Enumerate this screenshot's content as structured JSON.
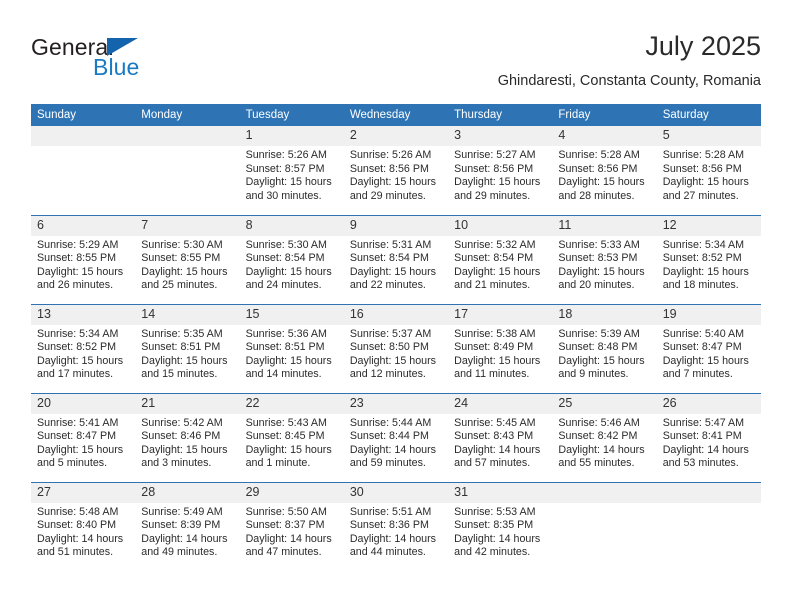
{
  "logo": {
    "word_one": "General",
    "word_two": "Blue",
    "triangle_color": "#1464ad",
    "blue_text_color": "#1a7ac4"
  },
  "header": {
    "month_title": "July 2025",
    "location": "Ghindaresti, Constanta County, Romania"
  },
  "theme": {
    "header_blue": "#2e74b5",
    "daynum_band": "#f0f0f0",
    "body_text": "#2b2b2b"
  },
  "weekday_headers": [
    "Sunday",
    "Monday",
    "Tuesday",
    "Wednesday",
    "Thursday",
    "Friday",
    "Saturday"
  ],
  "labels": {
    "sunrise_prefix": "Sunrise:",
    "sunset_prefix": "Sunset:",
    "daylight_prefix": "Daylight:"
  },
  "weeks": [
    [
      {
        "day": "",
        "empty": true,
        "sunrise": "",
        "sunset": "",
        "daylight_line1": "",
        "daylight_line2": ""
      },
      {
        "day": "",
        "empty": true,
        "sunrise": "",
        "sunset": "",
        "daylight_line1": "",
        "daylight_line2": ""
      },
      {
        "day": "1",
        "empty": false,
        "sunrise": "Sunrise: 5:26 AM",
        "sunset": "Sunset: 8:57 PM",
        "daylight_line1": "Daylight: 15 hours",
        "daylight_line2": "and 30 minutes."
      },
      {
        "day": "2",
        "empty": false,
        "sunrise": "Sunrise: 5:26 AM",
        "sunset": "Sunset: 8:56 PM",
        "daylight_line1": "Daylight: 15 hours",
        "daylight_line2": "and 29 minutes."
      },
      {
        "day": "3",
        "empty": false,
        "sunrise": "Sunrise: 5:27 AM",
        "sunset": "Sunset: 8:56 PM",
        "daylight_line1": "Daylight: 15 hours",
        "daylight_line2": "and 29 minutes."
      },
      {
        "day": "4",
        "empty": false,
        "sunrise": "Sunrise: 5:28 AM",
        "sunset": "Sunset: 8:56 PM",
        "daylight_line1": "Daylight: 15 hours",
        "daylight_line2": "and 28 minutes."
      },
      {
        "day": "5",
        "empty": false,
        "sunrise": "Sunrise: 5:28 AM",
        "sunset": "Sunset: 8:56 PM",
        "daylight_line1": "Daylight: 15 hours",
        "daylight_line2": "and 27 minutes."
      }
    ],
    [
      {
        "day": "6",
        "empty": false,
        "sunrise": "Sunrise: 5:29 AM",
        "sunset": "Sunset: 8:55 PM",
        "daylight_line1": "Daylight: 15 hours",
        "daylight_line2": "and 26 minutes."
      },
      {
        "day": "7",
        "empty": false,
        "sunrise": "Sunrise: 5:30 AM",
        "sunset": "Sunset: 8:55 PM",
        "daylight_line1": "Daylight: 15 hours",
        "daylight_line2": "and 25 minutes."
      },
      {
        "day": "8",
        "empty": false,
        "sunrise": "Sunrise: 5:30 AM",
        "sunset": "Sunset: 8:54 PM",
        "daylight_line1": "Daylight: 15 hours",
        "daylight_line2": "and 24 minutes."
      },
      {
        "day": "9",
        "empty": false,
        "sunrise": "Sunrise: 5:31 AM",
        "sunset": "Sunset: 8:54 PM",
        "daylight_line1": "Daylight: 15 hours",
        "daylight_line2": "and 22 minutes."
      },
      {
        "day": "10",
        "empty": false,
        "sunrise": "Sunrise: 5:32 AM",
        "sunset": "Sunset: 8:54 PM",
        "daylight_line1": "Daylight: 15 hours",
        "daylight_line2": "and 21 minutes."
      },
      {
        "day": "11",
        "empty": false,
        "sunrise": "Sunrise: 5:33 AM",
        "sunset": "Sunset: 8:53 PM",
        "daylight_line1": "Daylight: 15 hours",
        "daylight_line2": "and 20 minutes."
      },
      {
        "day": "12",
        "empty": false,
        "sunrise": "Sunrise: 5:34 AM",
        "sunset": "Sunset: 8:52 PM",
        "daylight_line1": "Daylight: 15 hours",
        "daylight_line2": "and 18 minutes."
      }
    ],
    [
      {
        "day": "13",
        "empty": false,
        "sunrise": "Sunrise: 5:34 AM",
        "sunset": "Sunset: 8:52 PM",
        "daylight_line1": "Daylight: 15 hours",
        "daylight_line2": "and 17 minutes."
      },
      {
        "day": "14",
        "empty": false,
        "sunrise": "Sunrise: 5:35 AM",
        "sunset": "Sunset: 8:51 PM",
        "daylight_line1": "Daylight: 15 hours",
        "daylight_line2": "and 15 minutes."
      },
      {
        "day": "15",
        "empty": false,
        "sunrise": "Sunrise: 5:36 AM",
        "sunset": "Sunset: 8:51 PM",
        "daylight_line1": "Daylight: 15 hours",
        "daylight_line2": "and 14 minutes."
      },
      {
        "day": "16",
        "empty": false,
        "sunrise": "Sunrise: 5:37 AM",
        "sunset": "Sunset: 8:50 PM",
        "daylight_line1": "Daylight: 15 hours",
        "daylight_line2": "and 12 minutes."
      },
      {
        "day": "17",
        "empty": false,
        "sunrise": "Sunrise: 5:38 AM",
        "sunset": "Sunset: 8:49 PM",
        "daylight_line1": "Daylight: 15 hours",
        "daylight_line2": "and 11 minutes."
      },
      {
        "day": "18",
        "empty": false,
        "sunrise": "Sunrise: 5:39 AM",
        "sunset": "Sunset: 8:48 PM",
        "daylight_line1": "Daylight: 15 hours",
        "daylight_line2": "and 9 minutes."
      },
      {
        "day": "19",
        "empty": false,
        "sunrise": "Sunrise: 5:40 AM",
        "sunset": "Sunset: 8:47 PM",
        "daylight_line1": "Daylight: 15 hours",
        "daylight_line2": "and 7 minutes."
      }
    ],
    [
      {
        "day": "20",
        "empty": false,
        "sunrise": "Sunrise: 5:41 AM",
        "sunset": "Sunset: 8:47 PM",
        "daylight_line1": "Daylight: 15 hours",
        "daylight_line2": "and 5 minutes."
      },
      {
        "day": "21",
        "empty": false,
        "sunrise": "Sunrise: 5:42 AM",
        "sunset": "Sunset: 8:46 PM",
        "daylight_line1": "Daylight: 15 hours",
        "daylight_line2": "and 3 minutes."
      },
      {
        "day": "22",
        "empty": false,
        "sunrise": "Sunrise: 5:43 AM",
        "sunset": "Sunset: 8:45 PM",
        "daylight_line1": "Daylight: 15 hours",
        "daylight_line2": "and 1 minute."
      },
      {
        "day": "23",
        "empty": false,
        "sunrise": "Sunrise: 5:44 AM",
        "sunset": "Sunset: 8:44 PM",
        "daylight_line1": "Daylight: 14 hours",
        "daylight_line2": "and 59 minutes."
      },
      {
        "day": "24",
        "empty": false,
        "sunrise": "Sunrise: 5:45 AM",
        "sunset": "Sunset: 8:43 PM",
        "daylight_line1": "Daylight: 14 hours",
        "daylight_line2": "and 57 minutes."
      },
      {
        "day": "25",
        "empty": false,
        "sunrise": "Sunrise: 5:46 AM",
        "sunset": "Sunset: 8:42 PM",
        "daylight_line1": "Daylight: 14 hours",
        "daylight_line2": "and 55 minutes."
      },
      {
        "day": "26",
        "empty": false,
        "sunrise": "Sunrise: 5:47 AM",
        "sunset": "Sunset: 8:41 PM",
        "daylight_line1": "Daylight: 14 hours",
        "daylight_line2": "and 53 minutes."
      }
    ],
    [
      {
        "day": "27",
        "empty": false,
        "sunrise": "Sunrise: 5:48 AM",
        "sunset": "Sunset: 8:40 PM",
        "daylight_line1": "Daylight: 14 hours",
        "daylight_line2": "and 51 minutes."
      },
      {
        "day": "28",
        "empty": false,
        "sunrise": "Sunrise: 5:49 AM",
        "sunset": "Sunset: 8:39 PM",
        "daylight_line1": "Daylight: 14 hours",
        "daylight_line2": "and 49 minutes."
      },
      {
        "day": "29",
        "empty": false,
        "sunrise": "Sunrise: 5:50 AM",
        "sunset": "Sunset: 8:37 PM",
        "daylight_line1": "Daylight: 14 hours",
        "daylight_line2": "and 47 minutes."
      },
      {
        "day": "30",
        "empty": false,
        "sunrise": "Sunrise: 5:51 AM",
        "sunset": "Sunset: 8:36 PM",
        "daylight_line1": "Daylight: 14 hours",
        "daylight_line2": "and 44 minutes."
      },
      {
        "day": "31",
        "empty": false,
        "sunrise": "Sunrise: 5:53 AM",
        "sunset": "Sunset: 8:35 PM",
        "daylight_line1": "Daylight: 14 hours",
        "daylight_line2": "and 42 minutes."
      },
      {
        "day": "",
        "empty": true,
        "sunrise": "",
        "sunset": "",
        "daylight_line1": "",
        "daylight_line2": ""
      },
      {
        "day": "",
        "empty": true,
        "sunrise": "",
        "sunset": "",
        "daylight_line1": "",
        "daylight_line2": ""
      }
    ]
  ]
}
